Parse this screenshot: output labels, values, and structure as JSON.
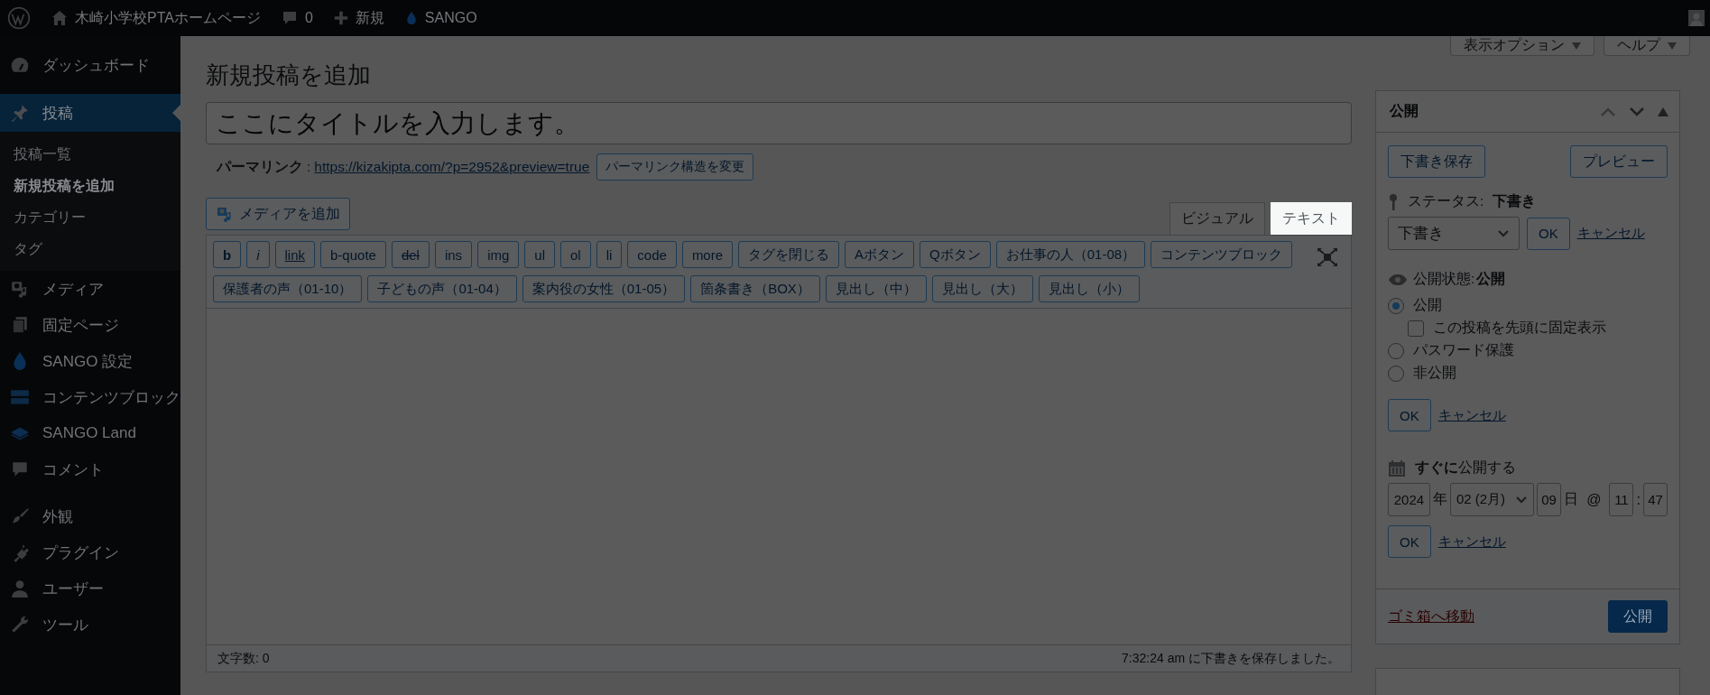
{
  "admin_bar": {
    "site_name": "木崎小学校PTAホームページ",
    "comments": "0",
    "new_label": "新規",
    "theme_label": "SANGO"
  },
  "sidebar": {
    "items": [
      {
        "label": "ダッシュボード",
        "selected": false,
        "separator_after": true
      },
      {
        "label": "投稿",
        "selected": true,
        "children": [
          {
            "label": "投稿一覧",
            "selected": false
          },
          {
            "label": "新規投稿を追加",
            "selected": true
          },
          {
            "label": "カテゴリー",
            "selected": false
          },
          {
            "label": "タグ",
            "selected": false
          }
        ]
      },
      {
        "label": "メディア",
        "selected": false
      },
      {
        "label": "固定ページ",
        "selected": false
      },
      {
        "label": "SANGO 設定",
        "selected": false
      },
      {
        "label": "コンテンツブロック",
        "selected": false
      },
      {
        "label": "SANGO Land",
        "selected": false
      },
      {
        "label": "コメント",
        "selected": false,
        "separator_after": true
      },
      {
        "label": "外観",
        "selected": false
      },
      {
        "label": "プラグイン",
        "selected": false
      },
      {
        "label": "ユーザー",
        "selected": false
      },
      {
        "label": "ツール",
        "selected": false
      }
    ]
  },
  "screen_meta": [
    "表示オプション",
    "ヘルプ"
  ],
  "page_title": "新規投稿を追加",
  "title_field": {
    "value": "ここにタイトルを入力します。"
  },
  "permalink": {
    "label": "パーマリンク",
    "separator": ":",
    "url": "https://kizakipta.com/?p=2952&preview=true",
    "button": "パーマリンク構造を変更"
  },
  "media_button": "メディアを追加",
  "editor_tabs": [
    {
      "label": "ビジュアル",
      "selected": false
    },
    {
      "label": "テキスト",
      "selected": true
    }
  ],
  "quicktags": [
    [
      {
        "label": "b",
        "kind": "bold"
      },
      {
        "label": "i",
        "kind": "italic"
      },
      {
        "label": "link",
        "kind": "link"
      },
      {
        "label": "b-quote",
        "kind": "plain"
      },
      {
        "label": "del",
        "kind": "del"
      },
      {
        "label": "ins",
        "kind": "plain"
      },
      {
        "label": "img",
        "kind": "plain"
      },
      {
        "label": "ul",
        "kind": "plain"
      },
      {
        "label": "ol",
        "kind": "plain"
      },
      {
        "label": "li",
        "kind": "plain"
      },
      {
        "label": "code",
        "kind": "plain"
      },
      {
        "label": "more",
        "kind": "plain"
      },
      {
        "label": "タグを閉じる",
        "kind": "plain"
      },
      {
        "label": "Aボタン",
        "kind": "plain"
      },
      {
        "label": "Qボタン",
        "kind": "plain"
      },
      {
        "label": "お仕事の人（01-08）",
        "kind": "plain"
      },
      {
        "label": "コンテンツブロック",
        "kind": "plain"
      }
    ],
    [
      {
        "label": "保護者の声（01-10）",
        "kind": "plain"
      },
      {
        "label": "子どもの声（01-04）",
        "kind": "plain"
      },
      {
        "label": "案内役の女性（01-05）",
        "kind": "plain"
      },
      {
        "label": "箇条書き（BOX）",
        "kind": "plain"
      },
      {
        "label": "見出し（中）",
        "kind": "plain"
      },
      {
        "label": "見出し（大）",
        "kind": "plain"
      },
      {
        "label": "見出し（小）",
        "kind": "plain"
      }
    ]
  ],
  "status_bar": {
    "word_count": "文字数: 0",
    "saved": "7:32:24 am に下書きを保存しました。"
  },
  "publish_box": {
    "title": "公開",
    "save_draft": "下書き保存",
    "preview": "プレビュー",
    "status": {
      "label": "ステータス:",
      "value": "下書き",
      "select": "下書き",
      "ok": "OK",
      "cancel": "キャンセル"
    },
    "visibility": {
      "label": "公開状態:",
      "value": "公開",
      "options": [
        {
          "label": "公開",
          "selected": true
        },
        {
          "label": "パスワード保護",
          "selected": false
        },
        {
          "label": "非公開",
          "selected": false
        }
      ],
      "sticky": {
        "label": "この投稿を先頭に固定表示",
        "checked": false
      },
      "ok": "OK",
      "cancel": "キャンセル"
    },
    "schedule": {
      "label": "**すぐに**公開する",
      "year": "2024",
      "year_unit": "年",
      "month": "02 (2月)",
      "day": "09",
      "day_unit": "日",
      "at": "@",
      "hour": "11",
      "colon": ":",
      "minute": "47",
      "ok": "OK",
      "cancel": "キャンセル"
    },
    "trash": "ゴミ箱へ移動",
    "publish": "公開"
  }
}
